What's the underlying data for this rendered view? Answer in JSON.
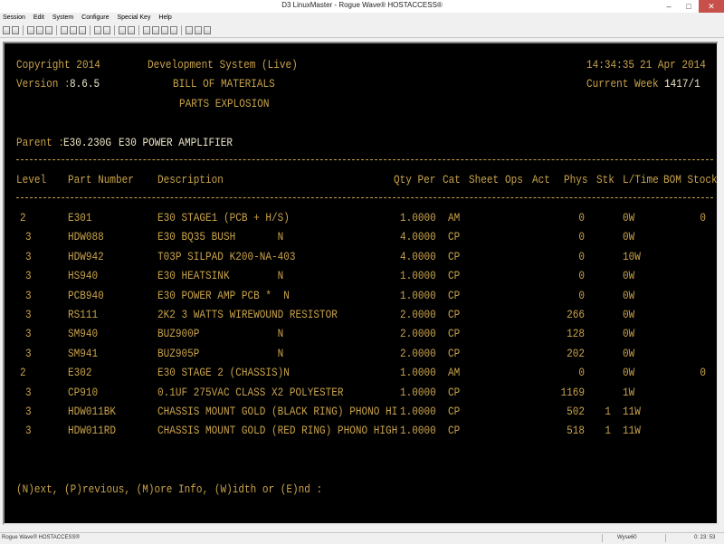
{
  "window": {
    "title": "D3 LinuxMaster - Rogue Wave® HOSTACCESS®",
    "minimize": "–",
    "maximize": "□",
    "close": "✕"
  },
  "menu": [
    "Session",
    "Edit",
    "System",
    "Configure",
    "Special Key",
    "Help"
  ],
  "terminal": {
    "copyright": "Copyright 2014",
    "version_label": "Version :",
    "version": "8.6.5",
    "system": "Development System (Live)",
    "title1": "BILL OF MATERIALS",
    "title2": "PARTS EXPLOSION",
    "time": "14:34:35",
    "date": "21 Apr 2014",
    "current_week_label": "Current Week :",
    "current_week": "1417/1",
    "parent_label": "Parent :",
    "parent_part": "E30.230G",
    "parent_desc": "E30 POWER AMPLIFIER",
    "columns": {
      "level": "Level",
      "part": "Part Number",
      "desc": "Description",
      "qty": "Qty Per",
      "cat": "Cat",
      "sheet": "Sheet",
      "ops": "Ops",
      "act": "Act",
      "phys": "Phys",
      "stk": "Stk",
      "ltime": "L/Time",
      "bom": "BOM Stock"
    },
    "rows": [
      {
        "level": "2",
        "part": "E301",
        "desc": "E30 STAGE1 (PCB + H/S)",
        "qty": "1.0000",
        "cat": "AM",
        "phys": "0",
        "stk": "",
        "ltime": "0W",
        "bom": "0"
      },
      {
        "level": "3",
        "part": "HDW088",
        "desc": "E30 BQ35 BUSH       N",
        "qty": "4.0000",
        "cat": "CP",
        "phys": "0",
        "stk": "",
        "ltime": "0W",
        "bom": ""
      },
      {
        "level": "3",
        "part": "HDW942",
        "desc": "T03P SILPAD K200-NA-403",
        "qty": "4.0000",
        "cat": "CP",
        "phys": "0",
        "stk": "",
        "ltime": "10W",
        "bom": ""
      },
      {
        "level": "3",
        "part": "HS940",
        "desc": "E30 HEATSINK        N",
        "qty": "1.0000",
        "cat": "CP",
        "phys": "0",
        "stk": "",
        "ltime": "0W",
        "bom": ""
      },
      {
        "level": "3",
        "part": "PCB940",
        "desc": "E30 POWER AMP PCB *  N",
        "qty": "1.0000",
        "cat": "CP",
        "phys": "0",
        "stk": "",
        "ltime": "0W",
        "bom": ""
      },
      {
        "level": "3",
        "part": "RS111",
        "desc": "2K2 3 WATTS WIREWOUND RESISTOR",
        "qty": "2.0000",
        "cat": "CP",
        "phys": "266",
        "stk": "",
        "ltime": "0W",
        "bom": ""
      },
      {
        "level": "3",
        "part": "SM940",
        "desc": "BUZ900P             N",
        "qty": "2.0000",
        "cat": "CP",
        "phys": "128",
        "stk": "",
        "ltime": "0W",
        "bom": ""
      },
      {
        "level": "3",
        "part": "SM941",
        "desc": "BUZ905P             N",
        "qty": "2.0000",
        "cat": "CP",
        "phys": "202",
        "stk": "",
        "ltime": "0W",
        "bom": ""
      },
      {
        "level": "2",
        "part": "E302",
        "desc": "E30 STAGE 2 (CHASSIS)N",
        "qty": "1.0000",
        "cat": "AM",
        "phys": "0",
        "stk": "",
        "ltime": "0W",
        "bom": "0"
      },
      {
        "level": "3",
        "part": "CP910",
        "desc": "0.1UF 275VAC CLASS X2 POLYESTER",
        "qty": "1.0000",
        "cat": "CP",
        "phys": "1169",
        "stk": "",
        "ltime": "1W",
        "bom": ""
      },
      {
        "level": "3",
        "part": "HDW011BK",
        "desc": "CHASSIS MOUNT GOLD (BLACK RING) PHONO HI",
        "qty": "1.0000",
        "cat": "CP",
        "phys": "502",
        "stk": "1",
        "ltime": "11W",
        "bom": ""
      },
      {
        "level": "3",
        "part": "HDW011RD",
        "desc": "CHASSIS MOUNT GOLD (RED RING) PHONO HIGH",
        "qty": "1.0000",
        "cat": "CP",
        "phys": "518",
        "stk": "1",
        "ltime": "11W",
        "bom": ""
      }
    ],
    "prompt": "(N)ext, (P)revious, (M)ore Info, (W)idth or (E)nd :"
  },
  "status": {
    "left": "Rogue Wave® HOSTACCESS®",
    "terminal": "Wyse60",
    "time": "0: 23: 53"
  }
}
